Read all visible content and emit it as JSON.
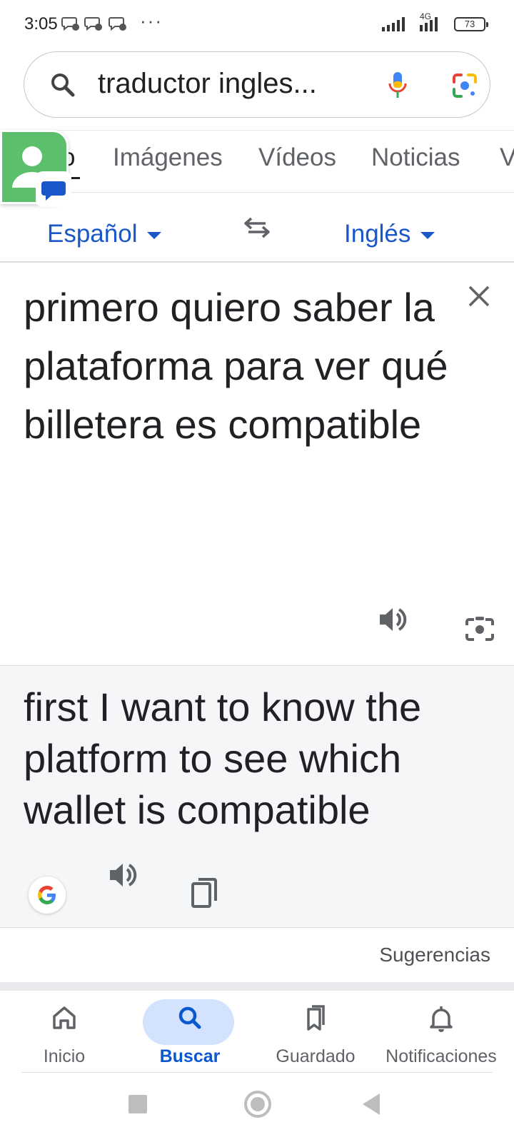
{
  "status_bar": {
    "time": "3:05",
    "network": "4G",
    "battery": "73",
    "more": "···"
  },
  "search": {
    "query": "traductor ingles..."
  },
  "tabs": [
    {
      "label": "o"
    },
    {
      "label": "Imágenes"
    },
    {
      "label": "Vídeos"
    },
    {
      "label": "Noticias"
    },
    {
      "label": "V"
    }
  ],
  "translator": {
    "source_language": "Español",
    "target_language": "Inglés",
    "source_text": "primero quiero saber la plataforma para ver qué billetera es compatible",
    "target_text": "first I want to know the platform to see which wallet is compatible",
    "suggestions_label": "Sugerencias"
  },
  "bottom_nav": [
    {
      "label": "Inicio",
      "icon": "home-icon"
    },
    {
      "label": "Buscar",
      "icon": "search-icon"
    },
    {
      "label": "Guardado",
      "icon": "bookmarks-icon"
    },
    {
      "label": "Notificaciones",
      "icon": "bell-icon"
    }
  ],
  "colors": {
    "accent_blue": "#1a57c9",
    "active_pill": "#d3e3fd",
    "contact_green": "#5bbf6b"
  }
}
